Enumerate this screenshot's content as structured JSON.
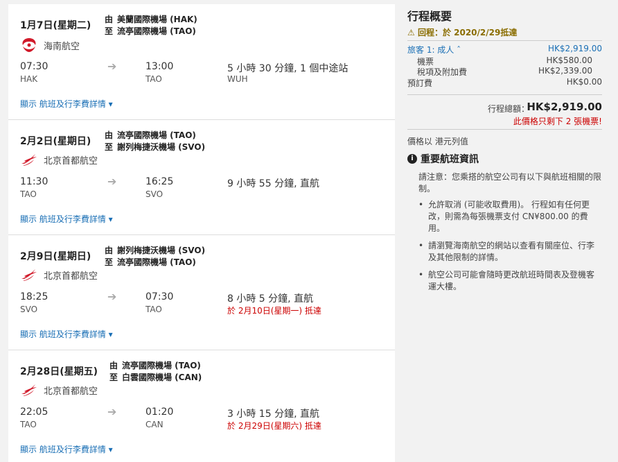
{
  "flights": [
    {
      "date": "1月7日(星期二)",
      "from_label": "由",
      "from_airport": "美蘭國際機場 (HAK)",
      "to_label": "至",
      "to_airport": "流亭國際機場 (TAO)",
      "airline": "海南航空",
      "depart_time": "07:30",
      "depart_code": "HAK",
      "arrive_time": "13:00",
      "arrive_code": "TAO",
      "duration": "5 小時 30 分鐘, 1 個中途站",
      "stop_code": "WUH",
      "arrive_note": "",
      "details_link": "顯示 航班及行李費詳情"
    },
    {
      "date": "2月2日(星期日)",
      "from_label": "由",
      "from_airport": "流亭國際機場 (TAO)",
      "to_label": "至",
      "to_airport": "謝列梅捷沃機場 (SVO)",
      "airline": "北京首都航空",
      "depart_time": "11:30",
      "depart_code": "TAO",
      "arrive_time": "16:25",
      "arrive_code": "SVO",
      "duration": "9 小時 55 分鐘, 直航",
      "stop_code": "",
      "arrive_note": "",
      "details_link": "顯示 航班及行李費詳情"
    },
    {
      "date": "2月9日(星期日)",
      "from_label": "由",
      "from_airport": "謝列梅捷沃機場 (SVO)",
      "to_label": "至",
      "to_airport": "流亭國際機場 (TAO)",
      "airline": "北京首都航空",
      "depart_time": "18:25",
      "depart_code": "SVO",
      "arrive_time": "07:30",
      "arrive_code": "TAO",
      "duration": "8 小時 5 分鐘, 直航",
      "stop_code": "",
      "arrive_note": "於 2月10日(星期一) 抵達",
      "details_link": "顯示 航班及行李費詳情"
    },
    {
      "date": "2月28日(星期五)",
      "from_label": "由",
      "from_airport": "流亭國際機場 (TAO)",
      "to_label": "至",
      "to_airport": "白雲國際機場 (CAN)",
      "airline": "北京首都航空",
      "depart_time": "22:05",
      "depart_code": "TAO",
      "arrive_time": "01:20",
      "arrive_code": "CAN",
      "duration": "3 小時 15 分鐘, 直航",
      "stop_code": "",
      "arrive_note": "於 2月29日(星期六) 抵達",
      "details_link": "顯示 航班及行李費詳情"
    }
  ],
  "summary": {
    "title": "行程概要",
    "return_note": "回程：於 2020/2/29抵達",
    "traveler_label": "旅客 1: 成人",
    "traveler_total": "HK$2,919.00",
    "ticket_label": "機票",
    "ticket_price": "HK$580.00",
    "tax_label": "稅項及附加費",
    "tax_price": "HK$2,339.00",
    "booking_fee_label": "預訂費",
    "booking_fee_price": "HK$0.00",
    "total_label": "行程總額：",
    "total_price": "HK$2,919.00",
    "tickets_left": "此價格只剩下 2 張機票!",
    "currency_note": "價格以 港元列值",
    "important_title": "重要航班資訊",
    "notice_intro": "請注意：您乘搭的航空公司有以下與航班相關的限制。",
    "notes": [
      "允許取消 (可能收取費用)。 行程如有任何更改，則需為每張機票支付 CN¥800.00 的費用。",
      "請瀏覽海南航空的網站以查看有關座位、行李及其他限制的詳情。",
      "航空公司可能會隨時更改航班時間表及登機客運大樓。"
    ]
  },
  "colors": {
    "link": "#1a6fb5",
    "alert": "#cc0000",
    "warning": "#8a6d00",
    "hainan_red": "#d11a2a"
  }
}
